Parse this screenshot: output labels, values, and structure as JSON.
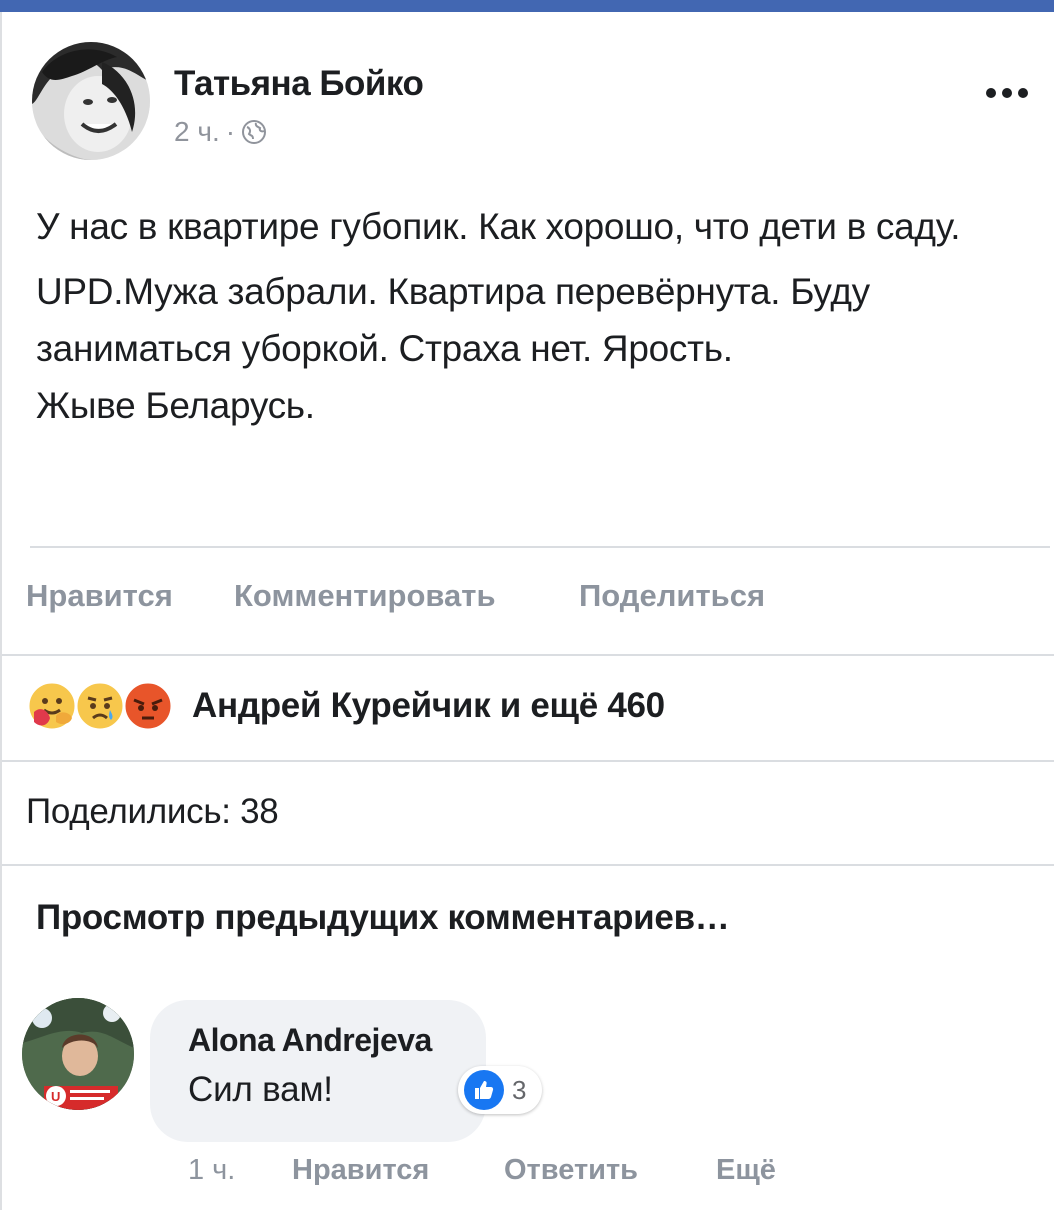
{
  "post": {
    "author": "Татьяна Бойко",
    "time": "2 ч.",
    "separator": "·",
    "privacy_icon": "globe-icon",
    "paragraphs": [
      "У нас в квартире губопик. Как хорошо, что дети в саду.",
      "UPD.Мужа забрали. Квартира перевёрнута. Буду заниматься уборкой. Страха нет. Ярость.\nЖыве Беларусь."
    ]
  },
  "actions": {
    "like": "Нравится",
    "comment": "Комментировать",
    "share": "Поделиться"
  },
  "reactions": {
    "icons": [
      "care-emoji-icon",
      "sad-emoji-icon",
      "angry-emoji-icon"
    ],
    "summary": "Андрей Курейчик и ещё 460"
  },
  "shares": "Поделились: 38",
  "view_previous": "Просмотр предыдущих комментариев…",
  "comment": {
    "author": "Alona Andrejeva",
    "text": "Сил вам!",
    "like_count": "3",
    "time": "1 ч.",
    "like": "Нравится",
    "reply": "Ответить",
    "more": "Ещё"
  },
  "colors": {
    "brand": "#4267b2",
    "like_blue": "#1877f2",
    "muted": "#8d949e",
    "text": "#1c1e21"
  }
}
